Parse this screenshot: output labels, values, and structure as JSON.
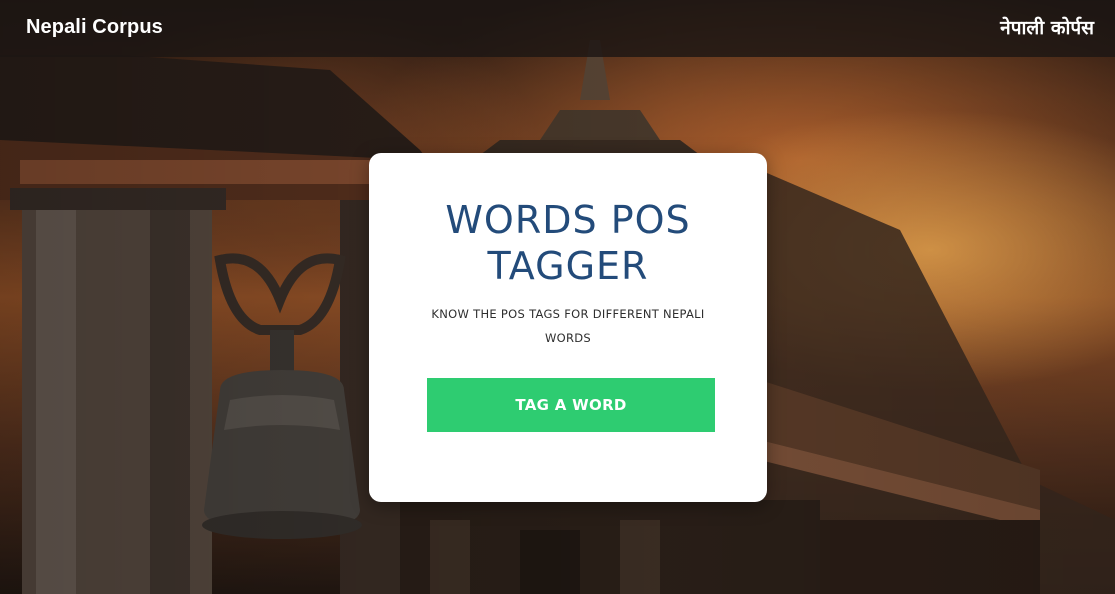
{
  "navbar": {
    "brand": "Nepali Corpus",
    "brand_nepali": "नेपाली कोर्पस"
  },
  "hero": {
    "background_description_icon": "temple-bell-background-image"
  },
  "card": {
    "title": "WORDS POS TAGGER",
    "subtitle": "KNOW THE POS TAGS FOR DIFFERENT NEPALI WORDS",
    "button_label": "TAG A WORD"
  },
  "colors": {
    "title": "#234b7a",
    "button": "#2ecc71",
    "navbar": "#1c1613"
  }
}
